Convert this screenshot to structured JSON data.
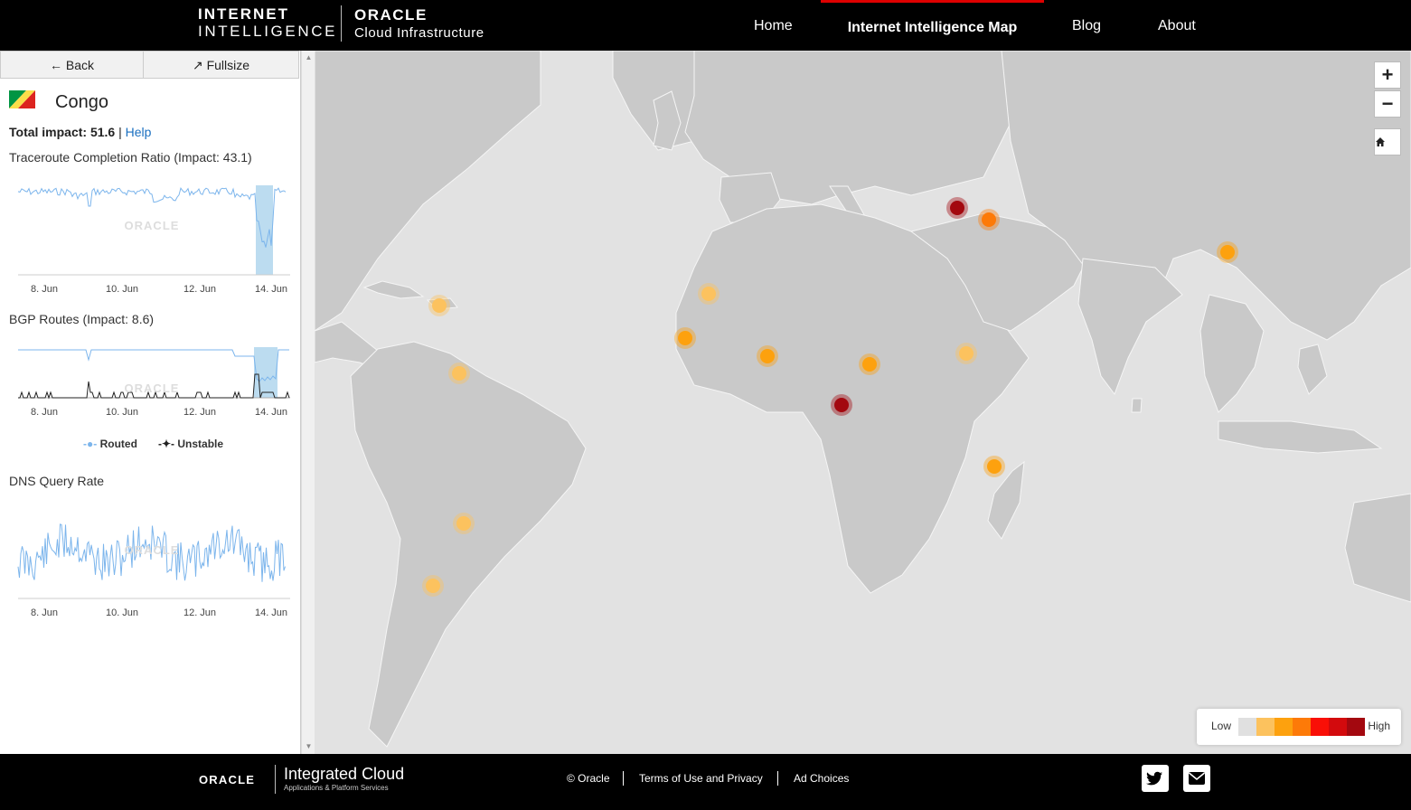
{
  "header": {
    "brand_line1": "INTERNET",
    "brand_line2": "INTELLIGENCE",
    "oracle_logo": "ORACLE",
    "oracle_sub": "Cloud Infrastructure",
    "nav": [
      {
        "label": "Home",
        "active": false
      },
      {
        "label": "Internet Intelligence Map",
        "active": true
      },
      {
        "label": "Blog",
        "active": false
      },
      {
        "label": "About",
        "active": false
      }
    ]
  },
  "sidebar": {
    "back_label": "← Back",
    "fullsize_label": "↗ Fullsize",
    "country": "Congo",
    "flag_colors": [
      "#009543",
      "#fbde4a",
      "#dc241f"
    ],
    "total_impact_label": "Total impact:",
    "total_impact_value": "51.6",
    "help_separator": "|",
    "help_label": "Help",
    "charts": [
      {
        "title": "Traceroute Completion Ratio (Impact: 43.1)",
        "ticks": [
          "8. Jun",
          "10. Jun",
          "12. Jun",
          "14. Jun"
        ],
        "watermark": "ORACLE"
      },
      {
        "title": "BGP Routes (Impact: 8.6)",
        "ticks": [
          "8. Jun",
          "10. Jun",
          "12. Jun",
          "14. Jun"
        ],
        "watermark": "ORACLE"
      },
      {
        "title": "DNS Query Rate",
        "ticks": [
          "8. Jun",
          "10. Jun",
          "12. Jun",
          "14. Jun"
        ],
        "watermark": "ORACLE"
      }
    ],
    "bgp_legend": {
      "routed": "Routed",
      "unstable": "Unstable"
    }
  },
  "map": {
    "zoom_in": "+",
    "zoom_out": "−",
    "home_icon": "home-icon",
    "legend": {
      "low": "Low",
      "high": "High",
      "swatches": [
        "#e0e0e0",
        "#fcc25e",
        "#fda10e",
        "#fd7a08",
        "#f90f07",
        "#d30a0d",
        "#a3080f"
      ]
    },
    "land_color": "#c9c9c9",
    "ocean_color": "#e2e2e2"
  },
  "footer": {
    "oracle": "ORACLE",
    "integrated_cloud": "Integrated Cloud",
    "integrated_sub": "Applications & Platform Services",
    "links": [
      "© Oracle",
      "Terms of Use and Privacy",
      "Ad Choices"
    ],
    "social": [
      "twitter-icon",
      "email-icon"
    ]
  }
}
